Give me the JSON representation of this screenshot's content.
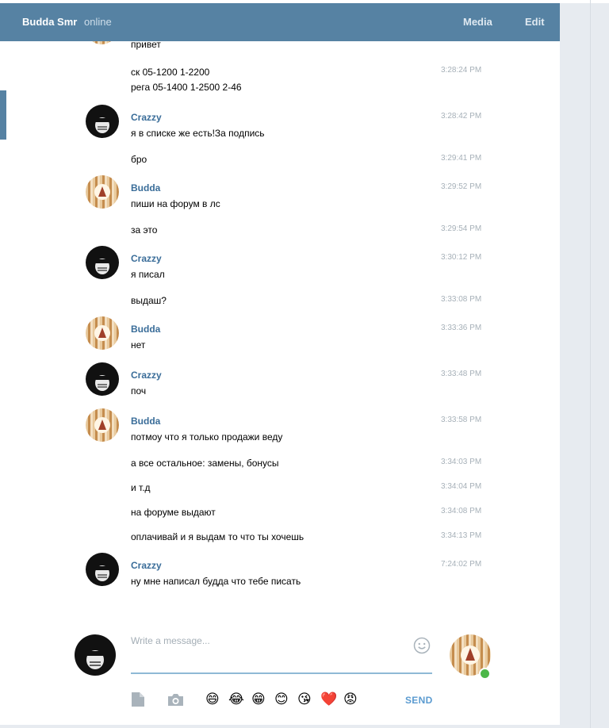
{
  "header": {
    "name": "Budda Smr",
    "status": "online",
    "media_label": "Media",
    "edit_label": "Edit"
  },
  "messages": [
    {
      "sender": "",
      "text": "привет",
      "time": ""
    },
    {
      "sender": "",
      "text": "ск 05-1200 1-2200\nрега 05-1400 1-2500 2-46",
      "time": "3:28:24 PM"
    },
    {
      "sender": "Crazzy",
      "text": "я в списке же есть!За подпись",
      "time": "3:28:42 PM"
    },
    {
      "sender": "",
      "text": "бро",
      "time": "3:29:41 PM"
    },
    {
      "sender": "Budda",
      "text": "пиши на форум в лс",
      "time": "3:29:52 PM"
    },
    {
      "sender": "",
      "text": "за это",
      "time": "3:29:54 PM"
    },
    {
      "sender": "Crazzy",
      "text": "я писал",
      "time": "3:30:12 PM"
    },
    {
      "sender": "",
      "text": "выдаш?",
      "time": "3:33:08 PM"
    },
    {
      "sender": "Budda",
      "text": "нет",
      "time": "3:33:36 PM"
    },
    {
      "sender": "Crazzy",
      "text": "поч",
      "time": "3:33:48 PM"
    },
    {
      "sender": "Budda",
      "text": "потмоу что я только продажи веду",
      "time": "3:33:58 PM"
    },
    {
      "sender": "",
      "text": "а все остальное: замены, бонусы",
      "time": "3:34:03 PM"
    },
    {
      "sender": "",
      "text": "и т.д",
      "time": "3:34:04 PM"
    },
    {
      "sender": "",
      "text": "на форуме выдают",
      "time": "3:34:08 PM"
    },
    {
      "sender": "",
      "text": "оплачивай и я выдам то что ты хочешь",
      "time": "3:34:13 PM"
    },
    {
      "sender": "Crazzy",
      "text": "ну мне написал будда что тебе писать",
      "time": "7:24:02 PM"
    }
  ],
  "composer": {
    "placeholder": "Write a message...",
    "send_label": "SEND",
    "emojis": [
      "😄",
      "😂",
      "😁",
      "😊",
      "😘",
      "❤️",
      "😡"
    ]
  },
  "colors": {
    "header_bg": "#5682a3",
    "sender_name": "#3a6d99",
    "send_button": "#5b9bd0",
    "online_dot": "#4cb749"
  },
  "icons": {
    "emoji_toggle": "smiley-icon",
    "attach_file": "file-icon",
    "attach_photo": "camera-icon"
  }
}
